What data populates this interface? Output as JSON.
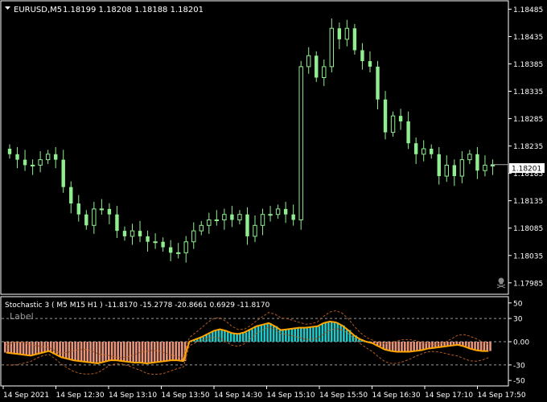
{
  "header": {
    "symbol_label": "EURUSD,M5",
    "ohlc": "1.18199 1.18208 1.18188 1.18201"
  },
  "price_axis": {
    "labels": [
      "1.18485",
      "1.18435",
      "1.18385",
      "1.18335",
      "1.18285",
      "1.18235",
      "1.18185",
      "1.18135",
      "1.18085",
      "1.18035",
      "1.17985"
    ],
    "current_price": "1.18201"
  },
  "indicator": {
    "title": "Stochastic 3 ( M5  M15  H1 ) -11.8170 -15.2778 -20.8661 0.6929 -11.8170",
    "label_text": "Label",
    "levels": [
      "50",
      "30",
      "0.00",
      "-30",
      "-50"
    ]
  },
  "time_axis": {
    "labels": [
      "14 Sep 2021",
      "14 Sep 12:30",
      "14 Sep 13:10",
      "14 Sep 13:50",
      "14 Sep 14:30",
      "14 Sep 15:10",
      "14 Sep 15:50",
      "14 Sep 16:30",
      "14 Sep 17:10",
      "14 Sep 17:50"
    ]
  },
  "colors": {
    "background": "#000000",
    "candle": "#90ee90",
    "grid": "#808080",
    "hist_positive": "#20c8c8",
    "hist_negative": "#e8957a",
    "main_line": "#ffa500",
    "band_line": "#b05a20"
  },
  "icons": {
    "dropdown": "triangle-down-icon",
    "skull": "skull-icon"
  },
  "chart_data": [
    {
      "type": "candlestick",
      "symbol": "EURUSD",
      "timeframe": "M5",
      "ylim": [
        1.1797,
        1.1849
      ],
      "close": [
        1.1822,
        1.1821,
        1.182,
        1.182,
        1.1821,
        1.1822,
        1.1821,
        1.1816,
        1.1813,
        1.1811,
        1.1809,
        1.1812,
        1.1812,
        1.1811,
        1.1808,
        1.1807,
        1.1808,
        1.1807,
        1.1806,
        1.1806,
        1.1805,
        1.1804,
        1.1804,
        1.1806,
        1.1808,
        1.1809,
        1.181,
        1.181,
        1.1811,
        1.181,
        1.1811,
        1.1807,
        1.1809,
        1.1811,
        1.1811,
        1.1812,
        1.1811,
        1.181,
        1.1838,
        1.184,
        1.1836,
        1.1838,
        1.1845,
        1.1843,
        1.1845,
        1.1841,
        1.1839,
        1.1838,
        1.1832,
        1.1826,
        1.1829,
        1.1828,
        1.1824,
        1.1822,
        1.1823,
        1.1822,
        1.1818,
        1.182,
        1.1818,
        1.1821,
        1.1822,
        1.1819,
        1.182,
        1.182
      ],
      "price_label": 1.18201,
      "y_ticks": [
        1.18485,
        1.18435,
        1.18385,
        1.18335,
        1.18285,
        1.18235,
        1.18185,
        1.18135,
        1.18085,
        1.18035,
        1.17985
      ]
    },
    {
      "type": "bar",
      "indicator": "Stochastic 3",
      "ylim": [
        -55,
        55
      ],
      "levels": [
        30,
        0,
        -30
      ],
      "histogram": [
        -14,
        -15,
        -16,
        -17,
        -18,
        -16,
        -14,
        -12,
        -16,
        -20,
        -22,
        -24,
        -25,
        -26,
        -27,
        -28,
        -26,
        -24,
        -24,
        -25,
        -26,
        -27,
        -27,
        -28,
        -27,
        -26,
        -25,
        -24,
        -24,
        -25,
        0,
        3,
        6,
        10,
        14,
        16,
        14,
        11,
        10,
        12,
        16,
        20,
        22,
        24,
        20,
        15,
        16,
        17,
        18,
        18,
        19,
        20,
        24,
        26,
        25,
        21,
        15,
        8,
        3,
        0,
        -2,
        -6,
        -10,
        -12,
        -13,
        -13,
        -13,
        -12,
        -11,
        -9,
        -8,
        -7,
        -6,
        -5,
        -4,
        -6,
        -9,
        -11,
        -12,
        -12
      ]
    }
  ]
}
